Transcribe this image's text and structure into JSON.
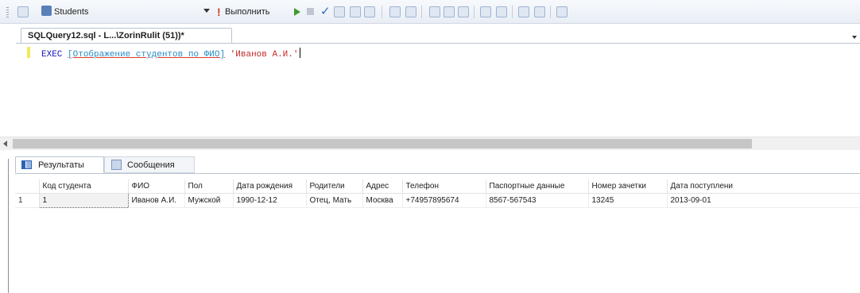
{
  "toolbar": {
    "database": "Students",
    "execute_label": "Выполнить"
  },
  "document_tab": {
    "title": "SQLQuery12.sql - L...\\ZorinRulit (51))*"
  },
  "editor": {
    "keyword": "EXEC",
    "procedure": "[Отображение студентов по ФИО]",
    "argument": "'Иванов А.И.'"
  },
  "results_tabs": [
    {
      "label": "Результаты"
    },
    {
      "label": "Сообщения"
    }
  ],
  "grid": {
    "columns": [
      "Код студента",
      "ФИО",
      "Пол",
      "Дата рождения",
      "Родители",
      "Адрес",
      "Телефон",
      "Паспортные данные",
      "Номер зачетки",
      "Дата поступлени"
    ],
    "rows": [
      {
        "num": "1",
        "cells": [
          "1",
          "Иванов А.И.",
          "Мужской",
          "1990-12-12",
          "Отец, Мать",
          "Москва",
          "+74957895674",
          "8567-567543",
          "13245",
          "2013-09-01"
        ]
      }
    ]
  },
  "colors": {
    "keyword": "#1818b8",
    "object": "#2b8cc4",
    "string": "#c52a2a",
    "execute": "#d33b1f"
  }
}
